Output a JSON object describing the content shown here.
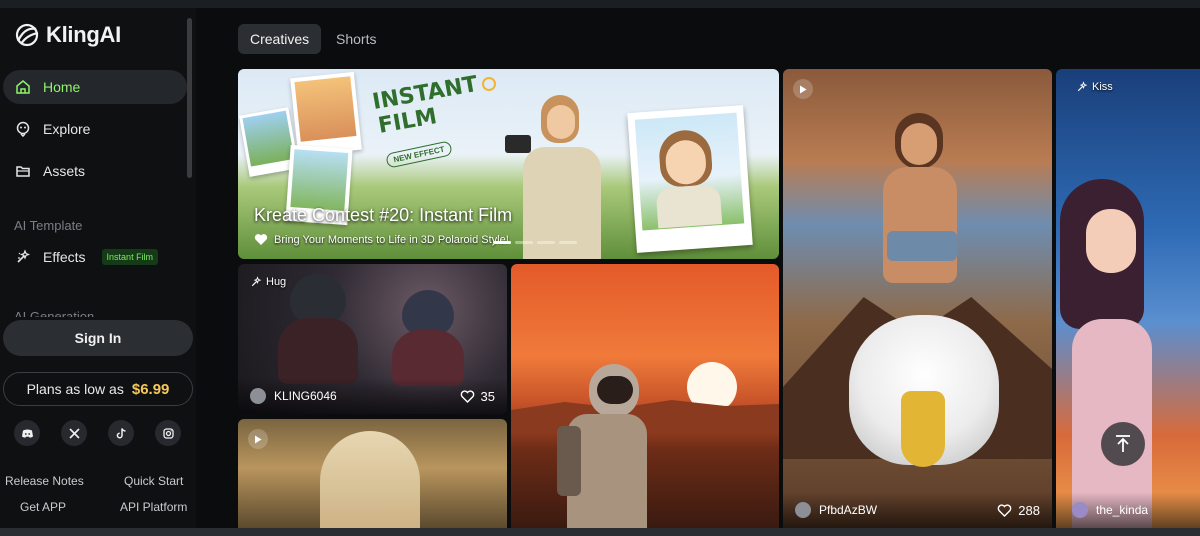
{
  "app": {
    "name": "KlingAI"
  },
  "sidebar": {
    "nav": [
      {
        "label": "Home",
        "icon": "home-icon"
      },
      {
        "label": "Explore",
        "icon": "explore-icon"
      },
      {
        "label": "Assets",
        "icon": "folder-icon"
      }
    ],
    "section_template": "AI Template",
    "effects": {
      "label": "Effects",
      "icon": "effects-icon",
      "badge": "Instant Film"
    },
    "section_generation": "AI Generation",
    "signin_label": "Sign In",
    "plans": {
      "text": "Plans as low as",
      "price": "$6.99"
    },
    "social": [
      "discord-icon",
      "x-icon",
      "tiktok-icon",
      "instagram-icon"
    ],
    "footer_links": [
      "Release Notes",
      "Quick Start",
      "Get APP",
      "API Platform"
    ]
  },
  "tabs": [
    {
      "label": "Creatives",
      "active": true
    },
    {
      "label": "Shorts",
      "active": false
    }
  ],
  "hero": {
    "title": "Kreate Contest #20: Instant Film",
    "subtitle": "Bring Your Moments to Life in 3D Polaroid Style!",
    "art_title_1": "INSTANT",
    "art_title_2": "FILM",
    "art_badge": "NEW EFFECT"
  },
  "cards": [
    {
      "chip": "Hug",
      "user": "KLING6046",
      "likes": "35"
    },
    {
      "user": "PfbdAzBW",
      "likes": "288"
    },
    {
      "chip": "Kiss",
      "user": "the_kinda"
    }
  ],
  "colors": {
    "accent": "#8ff36b",
    "price": "#f6c85a"
  }
}
